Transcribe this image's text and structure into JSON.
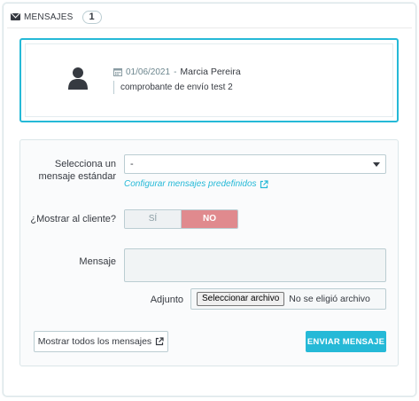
{
  "header": {
    "title": "MENSAJES",
    "count": "1",
    "icon": "envelope-icon"
  },
  "message": {
    "date": "01/06/2021",
    "separator": "-",
    "author": "Marcia Pereira",
    "text": "comprobante de envío test 2",
    "accent": "#25b9d7"
  },
  "form": {
    "select_label": "Selecciona un mensaje estándar",
    "select_value": "-",
    "config_link": "Configurar mensajes predefinidos",
    "show_label": "¿Mostrar al cliente?",
    "toggle_yes": "SÍ",
    "toggle_no": "NO",
    "toggle_selected": "NO",
    "message_label": "Mensaje",
    "message_value": "",
    "attachment_label": "Adjunto",
    "file_button": "Seleccionar archivo",
    "file_status": "No se eligió archivo",
    "show_all_button": "Mostrar todos los mensajes",
    "send_button": "ENVIAR MENSAJE",
    "send_color": "#25b9d7",
    "no_color": "#e08a8e"
  }
}
